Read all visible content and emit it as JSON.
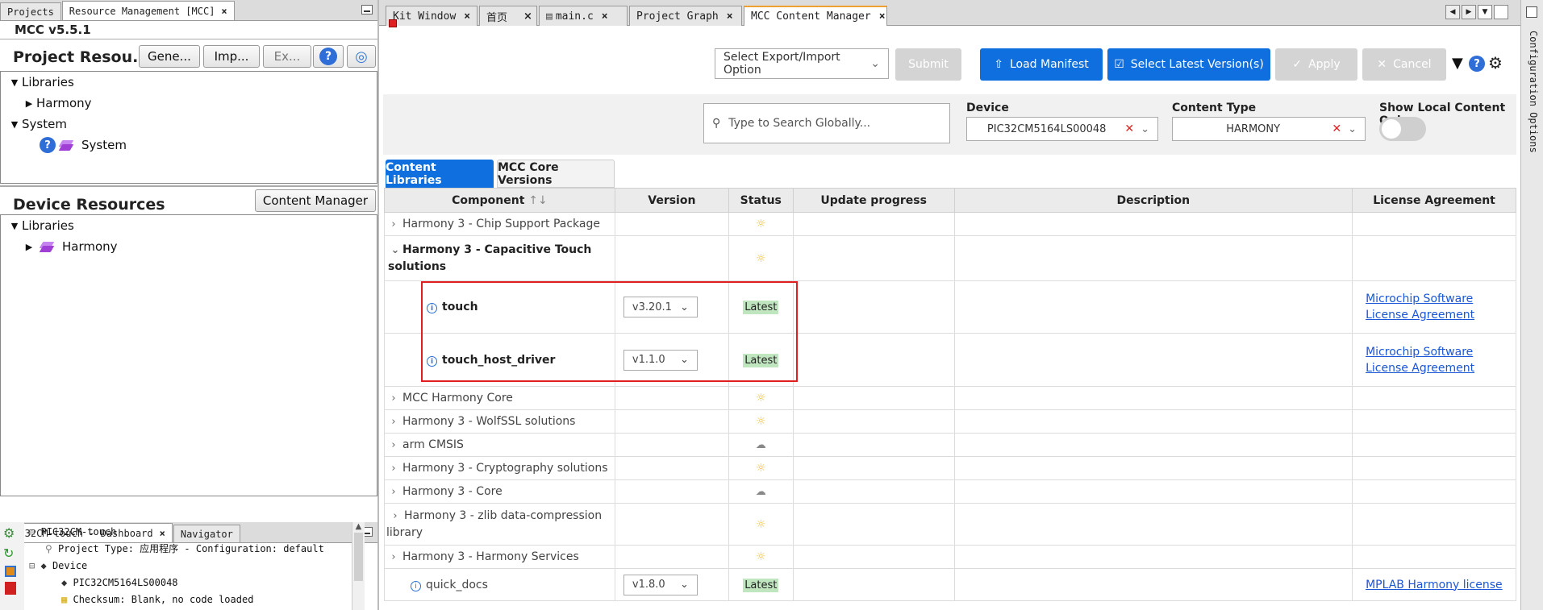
{
  "left": {
    "top_tabs": [
      {
        "label": "Projects"
      },
      {
        "label": "Resource Management [MCC]",
        "active": true
      }
    ],
    "mcc_version": "MCC v5.5.1",
    "project_resources": {
      "title": "Project Resou...",
      "buttons": {
        "generate": "Gene...",
        "import": "Imp...",
        "export": "Ex..."
      },
      "tree": {
        "libraries": "Libraries",
        "harmony": "Harmony",
        "system_group": "System",
        "system_item": "System"
      }
    },
    "device_resources": {
      "title": "Device Resources",
      "content_manager_button": "Content Manager",
      "tree": {
        "libraries": "Libraries",
        "harmony": "Harmony"
      }
    },
    "bottom_tabs": [
      {
        "label": "PIC32CM-touch - Dashboard",
        "active": true
      },
      {
        "label": "Navigator"
      }
    ],
    "dashboard": {
      "project": "PIC32CM-touch",
      "project_type": "Project Type: 应用程序 - Configuration: default",
      "device_label": "Device",
      "device_name": "PIC32CM5164LS00048",
      "checksum": "Checksum: Blank, no code loaded"
    }
  },
  "main": {
    "tabs": [
      {
        "label": "Kit Window"
      },
      {
        "label": "首页"
      },
      {
        "label": "main.c"
      },
      {
        "label": "Project Graph"
      },
      {
        "label": "MCC Content Manager",
        "active": true
      }
    ],
    "toolbar": {
      "export_import_placeholder": "Select Export/Import Option",
      "submit": "Submit",
      "load_manifest": "Load Manifest",
      "select_latest": "Select Latest Version(s)",
      "apply": "Apply",
      "cancel": "Cancel"
    },
    "filters": {
      "search_placeholder": "Type to Search Globally...",
      "device_label": "Device",
      "device_value": "PIC32CM5164LS00048",
      "content_type_label": "Content Type",
      "content_type_value": "HARMONY",
      "local_only_label": "Show Local Content Only"
    },
    "content_tabs": [
      {
        "label": "Content Libraries",
        "active": true
      },
      {
        "label": "MCC Core Versions"
      }
    ],
    "table": {
      "headers": [
        "Component",
        "Version",
        "Status",
        "Update progress",
        "Description",
        "License Agreement"
      ],
      "rows": [
        {
          "component": "Harmony 3 - Chip Support Package",
          "status_icon": "sun"
        },
        {
          "component": "Harmony 3 - Capacitive Touch solutions",
          "expanded": true,
          "status_icon": "sun"
        },
        {
          "component": "touch",
          "child": true,
          "version": "v3.20.1",
          "status": "Latest",
          "license": "Microchip Software License Agreement"
        },
        {
          "component": "touch_host_driver",
          "child": true,
          "version": "v1.1.0",
          "status": "Latest",
          "license": "Microchip Software License Agreement"
        },
        {
          "component": "MCC Harmony Core",
          "status_icon": "sun"
        },
        {
          "component": "Harmony 3 - WolfSSL solutions",
          "status_icon": "sun"
        },
        {
          "component": "arm CMSIS",
          "status_icon": "cloud"
        },
        {
          "component": "Harmony 3 - Cryptography solutions",
          "status_icon": "sun"
        },
        {
          "component": "Harmony 3 - Core",
          "status_icon": "cloud"
        },
        {
          "component": "Harmony 3 - zlib data-compression library",
          "status_icon": "sun"
        },
        {
          "component": "Harmony 3 - Harmony Services",
          "status_icon": "sun"
        },
        {
          "component": "quick_docs",
          "leaf": true,
          "version": "v1.8.0",
          "status": "Latest",
          "license": "MPLAB Harmony license"
        }
      ]
    },
    "highlight_color": "#e02020",
    "accent": "#0f6fde"
  },
  "right_strip": {
    "label": "Configuration Options"
  }
}
